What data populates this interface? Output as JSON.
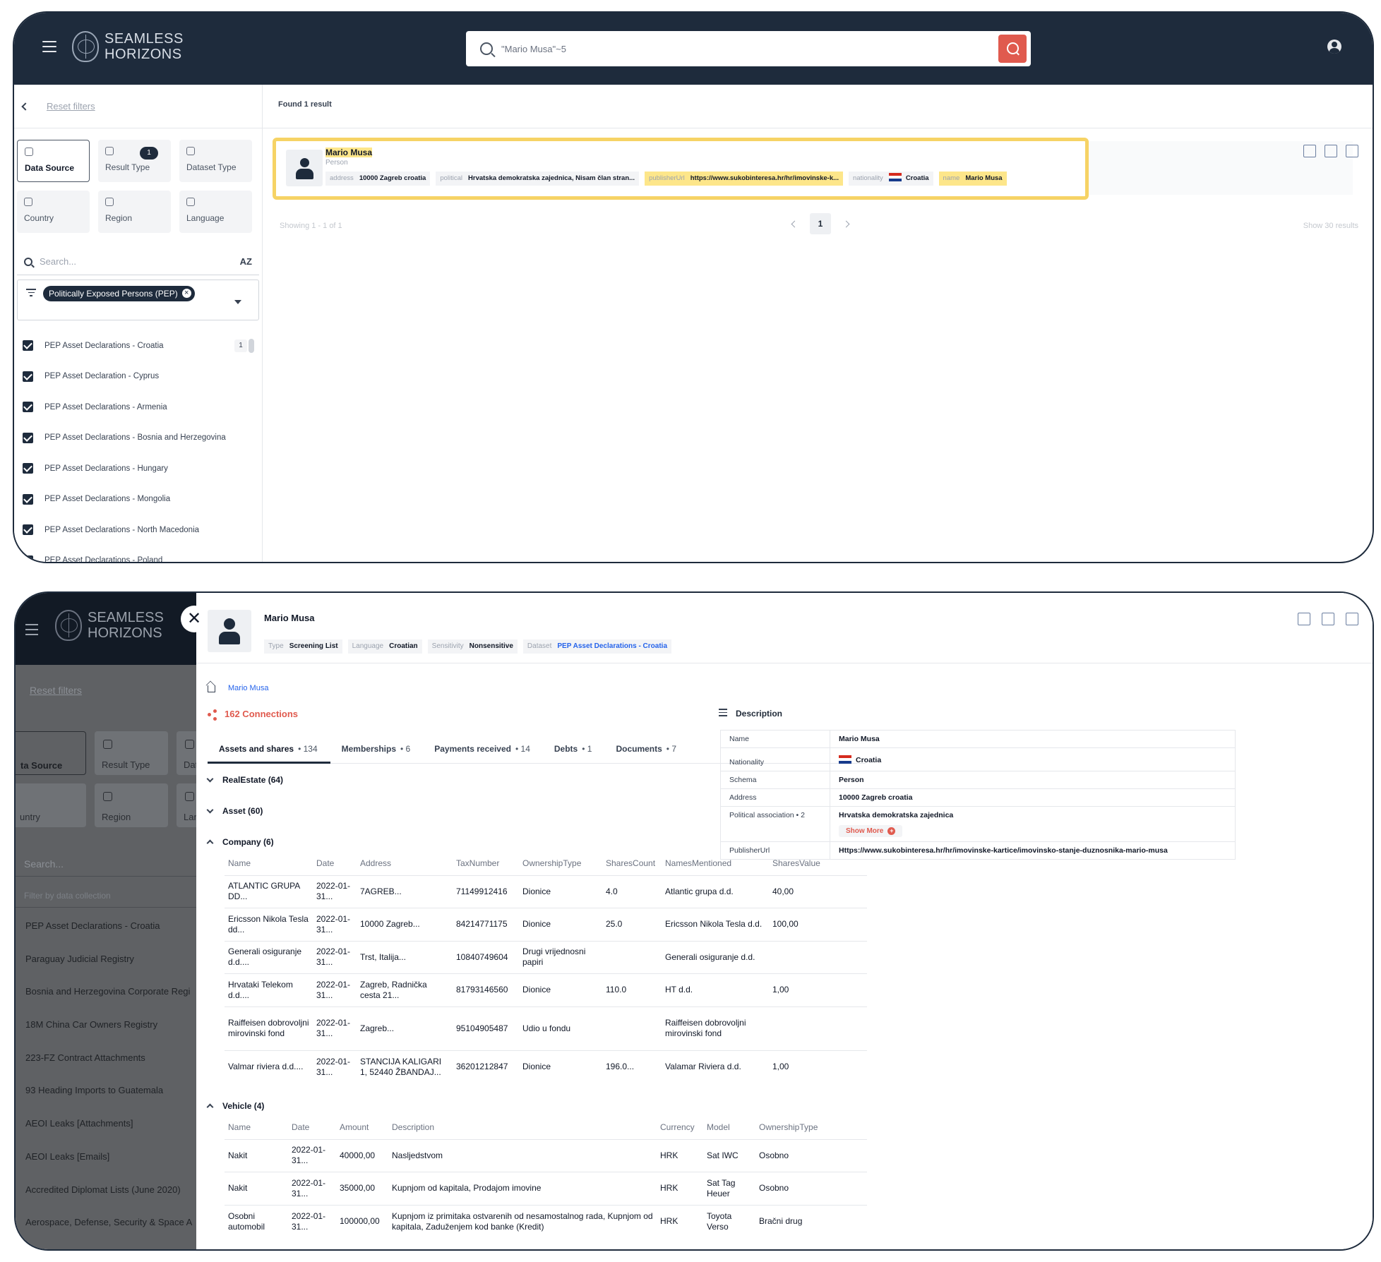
{
  "brand": {
    "line1": "SEAMLESS",
    "line2": "HORIZONS"
  },
  "search": {
    "query": "\"Mario Musa\"~5"
  },
  "sidebar": {
    "reset": "Reset filters",
    "tiles": [
      {
        "label": "Data Source"
      },
      {
        "label": "Result Type",
        "badge": "1"
      },
      {
        "label": "Dataset Type"
      },
      {
        "label": "Country"
      },
      {
        "label": "Region"
      },
      {
        "label": "Language"
      }
    ],
    "search_placeholder": "Search...",
    "sort_label": "AZ",
    "chip": "Politically Exposed Persons (PEP)",
    "items": [
      {
        "label": "PEP Asset Declarations - Croatia",
        "count": "1"
      },
      {
        "label": "PEP Asset Declaration - Cyprus"
      },
      {
        "label": "PEP Asset Declarations - Armenia"
      },
      {
        "label": "PEP Asset Declarations - Bosnia and Herzegovina"
      },
      {
        "label": "PEP Asset Declarations - Hungary"
      },
      {
        "label": "PEP Asset Declarations - Mongolia"
      },
      {
        "label": "PEP Asset Declarations - North Macedonia"
      },
      {
        "label": "PEP Asset Declarations - Poland"
      }
    ]
  },
  "results": {
    "found": "Found 1 result",
    "card": {
      "name": "Mario Musa",
      "type": "Person",
      "tags": [
        {
          "key": "address",
          "value": "10000 Zagreb croatia"
        },
        {
          "key": "political",
          "value": "Hrvatska demokratska zajednica, Nisam član stran..."
        },
        {
          "key": "publisherUrl",
          "value": "https://www.sukobinteresa.hr/hr/imovinske-k..."
        },
        {
          "key": "nationality",
          "value": "Croatia"
        },
        {
          "key": "name",
          "value": "Mario Musa"
        }
      ]
    },
    "showing": "Showing 1 - 1 of 1",
    "page": "1",
    "show_n": "Show 30 results"
  },
  "overlay": {
    "brand": {
      "line1": "SEAMLESS",
      "line2": "HORIZONS"
    },
    "reset": "Reset filters",
    "tiles": [
      "ta Source",
      "Result Type",
      "Dat",
      "untry",
      "Region",
      "Lan"
    ],
    "search": "Search...",
    "filter": "Filter by data collection",
    "items": [
      "PEP Asset Declarations - Croatia",
      "Paraguay Judicial Registry",
      "Bosnia and Herzegovina Corporate Regi",
      "18M China Car Owners Registry",
      "223-FZ Contract Attachments",
      "93 Heading Imports to Guatemala",
      "AEOI Leaks [Attachments]",
      "AEOI Leaks [Emails]",
      "Accredited Diplomat Lists (June 2020)",
      "Aerospace, Defense, Security & Space A"
    ],
    "close": "✕"
  },
  "detail": {
    "name": "Mario Musa",
    "tags": [
      {
        "key": "Type",
        "value": "Screening List"
      },
      {
        "key": "Language",
        "value": "Croatian"
      },
      {
        "key": "Sensitivity",
        "value": "Nonsensitive"
      },
      {
        "key": "Dataset",
        "value": "PEP Asset Declarations - Croatia"
      }
    ],
    "breadcrumb": "Mario Musa",
    "connections": "162 Connections",
    "tabs": [
      {
        "label": "Assets and shares",
        "count": "134"
      },
      {
        "label": "Memberships",
        "count": "6"
      },
      {
        "label": "Payments received",
        "count": "14"
      },
      {
        "label": "Debts",
        "count": "1"
      },
      {
        "label": "Documents",
        "count": "7"
      }
    ],
    "sections": {
      "realestate": "RealEstate (64)",
      "asset": "Asset (60)",
      "company": "Company (6)",
      "vehicle": "Vehicle (4)"
    },
    "company": {
      "headers": [
        "Name",
        "Date",
        "Address",
        "TaxNumber",
        "OwnershipType",
        "SharesCount",
        "NamesMentioned",
        "SharesValue"
      ],
      "rows": [
        [
          "ATLANTIC GRUPA DD...",
          "2022-01-31...",
          "7AGREB...",
          "71149912416",
          "Dionice",
          "4.0",
          "Atlantic grupa d.d.",
          "40,00"
        ],
        [
          "Ericsson Nikola Tesla dd...",
          "2022-01-31...",
          "10000 Zagreb...",
          "84214771175",
          "Dionice",
          "25.0",
          "Ericsson Nikola Tesla d.d.",
          "100,00"
        ],
        [
          "Generali osiguranje d.d....",
          "2022-01-31...",
          "Trst, Italija...",
          "10840749604",
          "Drugi vrijednosni papiri",
          "",
          "Generali osiguranje d.d.",
          ""
        ],
        [
          "Hrvataki Telekom d.d....",
          "2022-01-31...",
          "Zagreb, Radnička cesta 21...",
          "81793146560",
          "Dionice",
          "110.0",
          "HT d.d.",
          "1,00"
        ],
        [
          "Raiffeisen dobrovoljni mirovinski fond",
          "2022-01-31...",
          "Zagreb...",
          "95104905487",
          "Udio u fondu",
          "",
          "Raiffeisen dobrovoljni mirovinski fond",
          ""
        ],
        [
          "Valmar riviera d.d....",
          "2022-01-31...",
          "STANCIJA KALIGARI 1, 52440 ŽBANDAJ...",
          "36201212847",
          "Dionice",
          "196.0...",
          "Valamar Riviera d.d.",
          "1,00"
        ]
      ]
    },
    "vehicle": {
      "headers": [
        "Name",
        "Date",
        "Amount",
        "Description",
        "Currency",
        "Model",
        "OwnershipType"
      ],
      "rows": [
        [
          "Nakit",
          "2022-01-31...",
          "40000,00",
          "Nasljedstvom",
          "HRK",
          "Sat IWC",
          "Osobno"
        ],
        [
          "Nakit",
          "2022-01-31...",
          "35000,00",
          "Kupnjom od kapitala, Prodajom imovine",
          "HRK",
          "Sat Tag Heuer",
          "Osobno"
        ],
        [
          "Osobni automobil",
          "2022-01-31...",
          "100000,00",
          "Kupnjom iz primitaka ostvarenih od nesamostalnog rada, Kupnjom od kapitala, Zaduženjem kod banke (Kredit)",
          "HRK",
          "Toyota Verso",
          "Bračni drug"
        ]
      ]
    },
    "description": {
      "title": "Description",
      "rows": [
        {
          "key": "Name",
          "value": "Mario Musa"
        },
        {
          "key": "Nationality",
          "value": "Croatia"
        },
        {
          "key": "Schema",
          "value": "Person"
        },
        {
          "key": "Address",
          "value": "10000 Zagreb croatia"
        },
        {
          "key": "Political association • 2",
          "value": "Hrvatska demokratska zajednica"
        },
        {
          "key": "PublisherUrl",
          "value": "Https://www.sukobinteresa.hr/hr/imovinske-kartice/imovinsko-stanje-duznosnika-mario-musa"
        }
      ],
      "show_more": "Show More"
    }
  },
  "colors": {
    "navy": "#1e2b3c",
    "accent_red": "#e05a4e",
    "highlight": "#fde68a",
    "card_border": "#f6d365"
  },
  "icons": [
    "menu-icon",
    "brain-logo-icon",
    "search-icon",
    "user-icon",
    "chevron-left-icon",
    "database-icon",
    "filter-icon",
    "checkbox-icon",
    "person-avatar-icon",
    "compare-icon",
    "open-external-icon",
    "download-icon",
    "close-icon",
    "home-icon",
    "share-icon",
    "list-icon",
    "croatia-flag-icon"
  ]
}
